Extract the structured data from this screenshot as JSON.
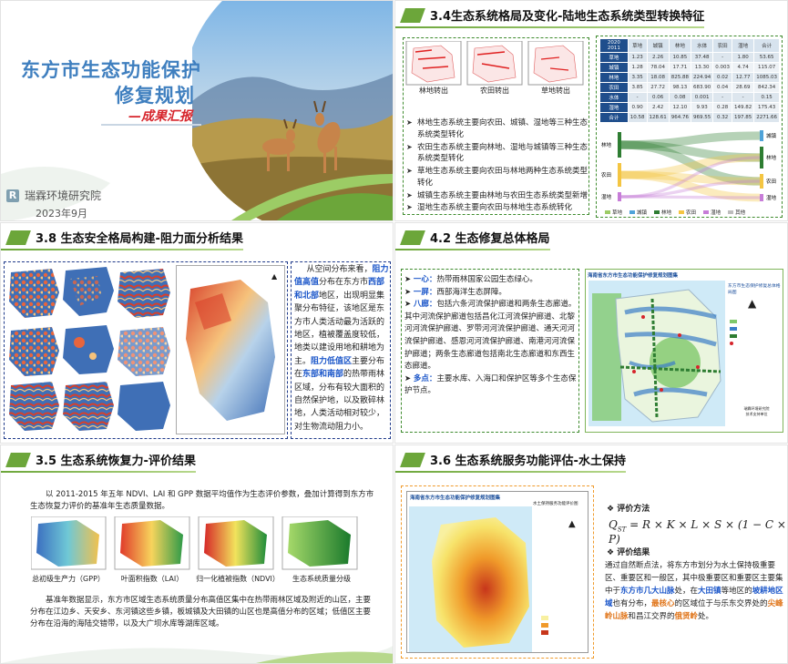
{
  "cover": {
    "title_line1": "东方市生态功能保护",
    "title_line2": "修复规划",
    "subtitle": "—成果汇报",
    "org": "瑞霖环境研究院",
    "date": "2023年9月",
    "colors": {
      "accent": "#3f7fbf",
      "brand": "#7f9fb0"
    }
  },
  "s34": {
    "title": "3.4生态系统格局及变化-陆地生态系统类型转换特征",
    "map_caps": [
      "林地转出",
      "农田转出",
      "草地转出"
    ],
    "bullets": [
      "林地生态系统主要向农田、城镇、湿地等三种生态系统类型转化",
      "农田生态系统主要向林地、湿地与城镇等三种生态系统类型转化",
      "草地生态系统主要向农田与林地两种生态系统类型转化",
      "城镇生态系统主要由林地与农田生态系统类型新增",
      "湿地生态系统主要向农田与林地生态系统转化"
    ],
    "table": {
      "corner": [
        "2020",
        "2011"
      ],
      "headers": [
        "草地",
        "城镇",
        "林地",
        "水体",
        "农田",
        "湿地",
        "合计"
      ],
      "rows": [
        {
          "label": "草地",
          "cells": [
            "1.23",
            "2.26",
            "10.85",
            "37.48",
            "-",
            "1.80",
            "53.65"
          ]
        },
        {
          "label": "城镇",
          "cells": [
            "1.28",
            "78.04",
            "17.71",
            "13.30",
            "0.003",
            "4.74",
            "115.07"
          ]
        },
        {
          "label": "林地",
          "cells": [
            "3.35",
            "18.08",
            "825.88",
            "224.94",
            "0.02",
            "12.77",
            "1085.03"
          ]
        },
        {
          "label": "农田",
          "cells": [
            "3.85",
            "27.72",
            "98.13",
            "683.90",
            "0.04",
            "28.69",
            "842.34"
          ]
        },
        {
          "label": "水体",
          "cells": [
            "-",
            "0.06",
            "0.08",
            "0.001",
            "-",
            "-",
            "0.15"
          ]
        },
        {
          "label": "湿地",
          "cells": [
            "0.90",
            "2.42",
            "12.10",
            "9.93",
            "0.28",
            "149.82",
            "175.43"
          ]
        },
        {
          "label": "合计",
          "cells": [
            "10.58",
            "128.61",
            "964.76",
            "969.55",
            "0.32",
            "197.85",
            "2271.66"
          ]
        }
      ]
    },
    "sankey_left": [
      "林地",
      "农田",
      "湿地"
    ],
    "sankey_right": [
      "城镇",
      "林地",
      "农田",
      "湿地"
    ],
    "legend": [
      "草地",
      "城镇",
      "林地",
      "农田",
      "湿地",
      "其他"
    ],
    "legend_colors": [
      "#9ccc65",
      "#4fa3d9",
      "#2e7d32",
      "#f4c542",
      "#c77dd8",
      "#bdbdbd"
    ]
  },
  "s38": {
    "title": "3.8 生态安全格局构建-阻力面分析结果",
    "para": [
      {
        "t": "从空间分布来看，",
        "c": ""
      },
      {
        "t": "阻力值高值",
        "c": "hl-b"
      },
      {
        "t": "分布在东方市",
        "c": ""
      },
      {
        "t": "西部和北部",
        "c": "hl-b"
      },
      {
        "t": "地区，出现明显集聚分布特征，该地区是东方市人类活动最为活跃的地区，植被覆盖度较低，地类以建设用地和耕地为主。",
        "c": ""
      },
      {
        "t": "阻力低值区",
        "c": "hl-b"
      },
      {
        "t": "主要分布在",
        "c": ""
      },
      {
        "t": "东部和南部",
        "c": "hl-b"
      },
      {
        "t": "的热带雨林区域，分布有较大面积的自然保护地，以及散碎林地，人类活动相对较少，对生物流动阻力小。",
        "c": ""
      }
    ]
  },
  "s42": {
    "title": "4.2 生态修复总体格局",
    "items": [
      {
        "k": "一心：",
        "v": "热带雨林国家公园生态绿心。"
      },
      {
        "k": "一屏：",
        "v": "西部海洋生态屏障。"
      },
      {
        "k": "八廊：",
        "v": "包括六条河流保护廊道和两条生态廊道。其中河流保护廊道包括昌化江河流保护廊道、北黎河河流保护廊道、罗带河河流保护廊道、通天河河流保护廊道、感恩河河流保护廊道、南港河河流保护廊道；两条生态廊道包括南北生态廊道和东西生态廊道。"
      },
      {
        "k": "多点：",
        "v": "主要水库、入海口和保护区等多个生态保护节点。"
      }
    ],
    "map_title": "海南省东方市生态功能保护修复规划图集",
    "map_sub": "东方市生态保护修复总体格局图",
    "map_note": "瑞霖环境研究院\n技术支持单位"
  },
  "s35": {
    "title": "3.5 生态系统恢复力-评价结果",
    "intro": "以 2011-2015 年五年 NDVI、LAI 和 GPP 数据平均值作为生态评价参数，叠加计算得到东方市生态恢复力评价的基准年生态质量数据。",
    "caps": [
      "总初级生产力（GPP）",
      "叶面积指数（LAI）",
      "归一化植被指数（NDVI）",
      "生态系统质量分级"
    ],
    "outro": "基准年数据显示，东方市区域生态系统质量分布高值区集中在热带雨林区域及附近的山区，主要分布在江边乡、天安乡、东河镇这些乡镇，板城镇及大田镇的山区也是高值分布的区域；低值区主要分布在沿海的海陆交错带，以及大广坝水库等湖库区域。"
  },
  "s36": {
    "title": "3.6 生态系统服务功能评估-水土保持",
    "map_title": "海南省东方市生态功能保护修复规划图集",
    "map_sub": "水土保持服务功能评价图",
    "method_label": "评价方法",
    "formula": "Q_{ST} = R × K × L × S × (1 − C × P)",
    "result_label": "评价结果",
    "result": [
      {
        "t": "通过自然断点法，将东方市划分为水土保持极重要区、重要区和一般区，其中极重要区和重要区主要集中于",
        "c": ""
      },
      {
        "t": "东方市几大山脉",
        "c": "hl-b"
      },
      {
        "t": "处，在",
        "c": ""
      },
      {
        "t": "大田镇",
        "c": "hl-b"
      },
      {
        "t": "等地区的",
        "c": ""
      },
      {
        "t": "坡耕地区域",
        "c": "hl-b"
      },
      {
        "t": "也有分布，",
        "c": ""
      },
      {
        "t": "最核心",
        "c": "hl-o"
      },
      {
        "t": "的区域位于与乐东交界处的",
        "c": ""
      },
      {
        "t": "尖峰岭山脉",
        "c": "hl-o"
      },
      {
        "t": "和昌江交界的",
        "c": ""
      },
      {
        "t": "俄贤岭",
        "c": "hl-o"
      },
      {
        "t": "处。",
        "c": ""
      }
    ]
  }
}
